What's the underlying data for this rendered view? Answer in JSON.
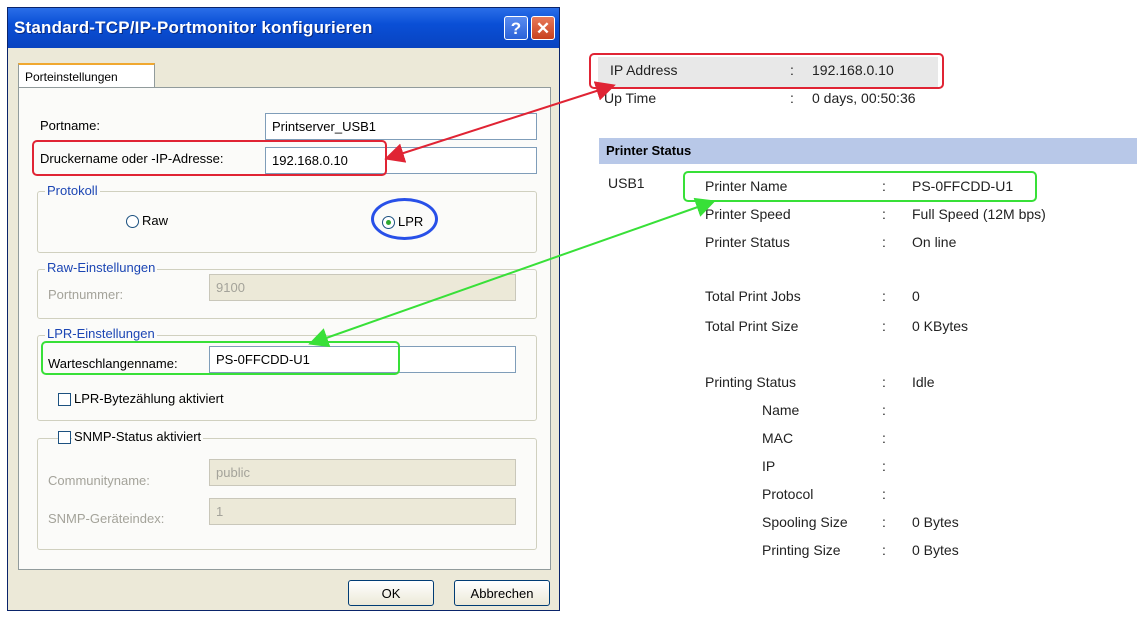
{
  "dialog": {
    "title": "Standard-TCP/IP-Portmonitor konfigurieren",
    "help_label": "?",
    "close_label": "✕",
    "tab_label": "Porteinstellungen",
    "port_name_label": "Portname:",
    "port_name_value": "Printserver_USB1",
    "printer_name_ip_label": "Druckername oder -IP-Adresse:",
    "printer_name_ip_value": "192.168.0.10",
    "protocol_legend": "Protokoll",
    "raw_label": "Raw",
    "lpr_label": "LPR",
    "raw_settings_legend": "Raw-Einstellungen",
    "port_number_label": "Portnummer:",
    "port_number_value": "9100",
    "lpr_settings_legend": "LPR-Einstellungen",
    "queue_name_label": "Warteschlangenname:",
    "queue_name_value": "PS-0FFCDD-U1",
    "lpr_byte_counting_label": "LPR-Bytezählung aktiviert",
    "snmp_label": "SNMP-Status aktiviert",
    "community_name_label": "Communityname:",
    "community_name_value": "public",
    "snmp_device_index_label": "SNMP-Geräteindex:",
    "snmp_device_index_value": "1",
    "ok_label": "OK",
    "cancel_label": "Abbrechen"
  },
  "status": {
    "ip_address_label": "IP Address",
    "ip_address_value": "192.168.0.10",
    "up_time_label": "Up Time",
    "up_time_value": "0 days, 00:50:36",
    "printer_status_title": "Printer Status",
    "port": "USB1",
    "printer_name_label": "Printer Name",
    "printer_name_value": "PS-0FFCDD-U1",
    "printer_speed_label": "Printer Speed",
    "printer_speed_value": "Full Speed (12M bps)",
    "printer_status_label": "Printer Status",
    "printer_status_value": "On line",
    "total_print_jobs_label": "Total Print Jobs",
    "total_print_jobs_value": "0",
    "total_print_size_label": "Total Print Size",
    "total_print_size_value": "0 KBytes",
    "printing_status_label": "Printing Status",
    "printing_status_value": "Idle",
    "name_label": "Name",
    "mac_label": "MAC",
    "ip_label": "IP",
    "protocol_label": "Protocol",
    "spooling_size_label": "Spooling Size",
    "spooling_size_value": "0 Bytes",
    "printing_size_label": "Printing Size",
    "printing_size_value": "0 Bytes",
    "colon": ":"
  },
  "colors": {
    "highlight_red": "#e02434",
    "highlight_green": "#38e038",
    "highlight_blue": "#2850e8",
    "titlebar_blue": "#0a4fd6",
    "status_header": "#b8c8e8"
  }
}
